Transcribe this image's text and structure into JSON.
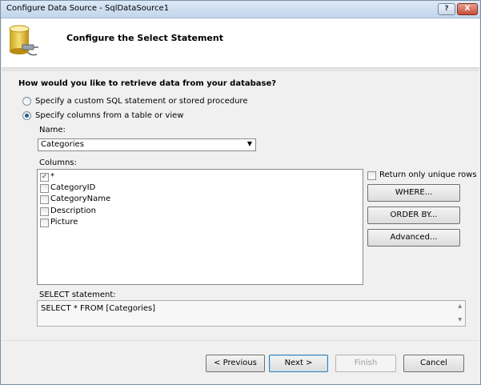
{
  "window": {
    "title": "Configure Data Source - SqlDataSource1",
    "help_label": "?",
    "close_label": "X"
  },
  "header": {
    "title": "Configure the Select Statement",
    "icon": "database-icon"
  },
  "question": "How would you like to retrieve data from your database?",
  "options": {
    "custom_sql": {
      "label": "Specify a custom SQL statement or stored procedure",
      "selected": false
    },
    "table_view": {
      "label": "Specify columns from a table or view",
      "selected": true
    }
  },
  "name": {
    "label": "Name:",
    "value": "Categories"
  },
  "columns": {
    "label": "Columns:",
    "items": [
      {
        "label": "*",
        "checked": true
      },
      {
        "label": "CategoryID",
        "checked": false
      },
      {
        "label": "CategoryName",
        "checked": false
      },
      {
        "label": "Description",
        "checked": false
      },
      {
        "label": "Picture",
        "checked": false
      }
    ]
  },
  "unique_rows": {
    "label": "Return only unique rows",
    "checked": false
  },
  "side_buttons": {
    "where": "WHERE...",
    "order_by": "ORDER BY...",
    "advanced": "Advanced..."
  },
  "select_statement": {
    "label": "SELECT statement:",
    "value": "SELECT * FROM [Categories]"
  },
  "footer": {
    "previous": "< Previous",
    "next": "Next >",
    "finish": "Finish",
    "cancel": "Cancel"
  },
  "colors": {
    "accent": "#3c7fb1",
    "titlebar": "#c3d6ec",
    "close": "#c74d39"
  }
}
